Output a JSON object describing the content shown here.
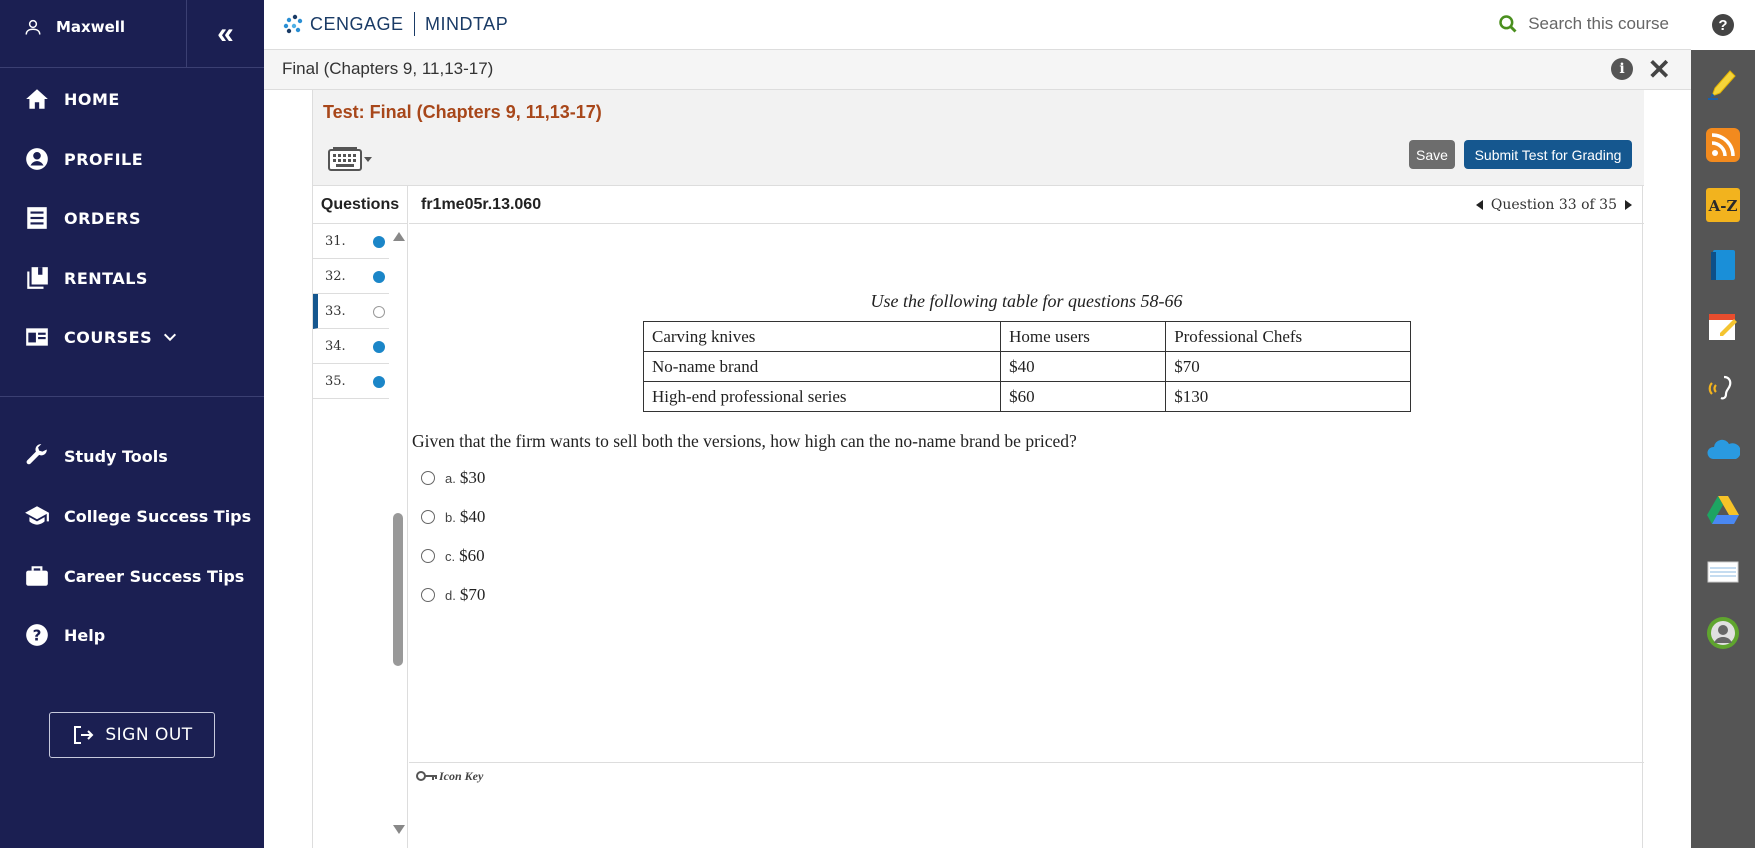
{
  "user": {
    "name": "Maxwell"
  },
  "nav": {
    "items": [
      {
        "label": "HOME",
        "icon": "home-icon"
      },
      {
        "label": "PROFILE",
        "icon": "profile-icon"
      },
      {
        "label": "ORDERS",
        "icon": "orders-icon"
      },
      {
        "label": "RENTALS",
        "icon": "rentals-icon"
      },
      {
        "label": "COURSES",
        "icon": "courses-icon"
      }
    ],
    "lower": [
      {
        "label": "Study Tools",
        "icon": "wrench-icon"
      },
      {
        "label": "College Success Tips",
        "icon": "graduation-cap-icon"
      },
      {
        "label": "Career Success Tips",
        "icon": "briefcase-icon"
      },
      {
        "label": "Help",
        "icon": "help-icon"
      }
    ],
    "signout": "SIGN OUT"
  },
  "topbar": {
    "brand_left": "CENGAGE",
    "brand_right": "MINDTAP",
    "search_placeholder": "Search this course"
  },
  "subbar": {
    "title": "Final (Chapters 9, 11,13-17)"
  },
  "test": {
    "title": "Test: Final (Chapters 9, 11,13-17)",
    "save_label": "Save",
    "submit_label": "Submit Test for Grading",
    "questions_header": "Questions",
    "question_id": "fr1me05r.13.060",
    "question_nav": "Question 33 of 35",
    "questions": [
      {
        "num": "31.",
        "answered": true
      },
      {
        "num": "32.",
        "answered": true
      },
      {
        "num": "33.",
        "answered": false,
        "current": true
      },
      {
        "num": "34.",
        "answered": true
      },
      {
        "num": "35.",
        "answered": true
      }
    ]
  },
  "question": {
    "caption": "Use the following table for questions 58-66",
    "table": [
      [
        "Carving knives",
        "Home users",
        "Professional Chefs"
      ],
      [
        "No-name brand",
        "$40",
        "$70"
      ],
      [
        "High-end professional series",
        "$60",
        "$130"
      ]
    ],
    "prompt": "Given that the firm wants to sell both the versions, how high can the no-name brand be priced?",
    "choices": [
      {
        "letter": "a.",
        "value": "$30"
      },
      {
        "letter": "b.",
        "value": "$40"
      },
      {
        "letter": "c.",
        "value": "$60"
      },
      {
        "letter": "d.",
        "value": "$70"
      }
    ],
    "icon_key": "Icon Key"
  },
  "colors": {
    "nav_bg": "#1b1f52",
    "title_accent": "#a8471a",
    "primary": "#15578f",
    "answered_dot": "#1b86c8"
  }
}
